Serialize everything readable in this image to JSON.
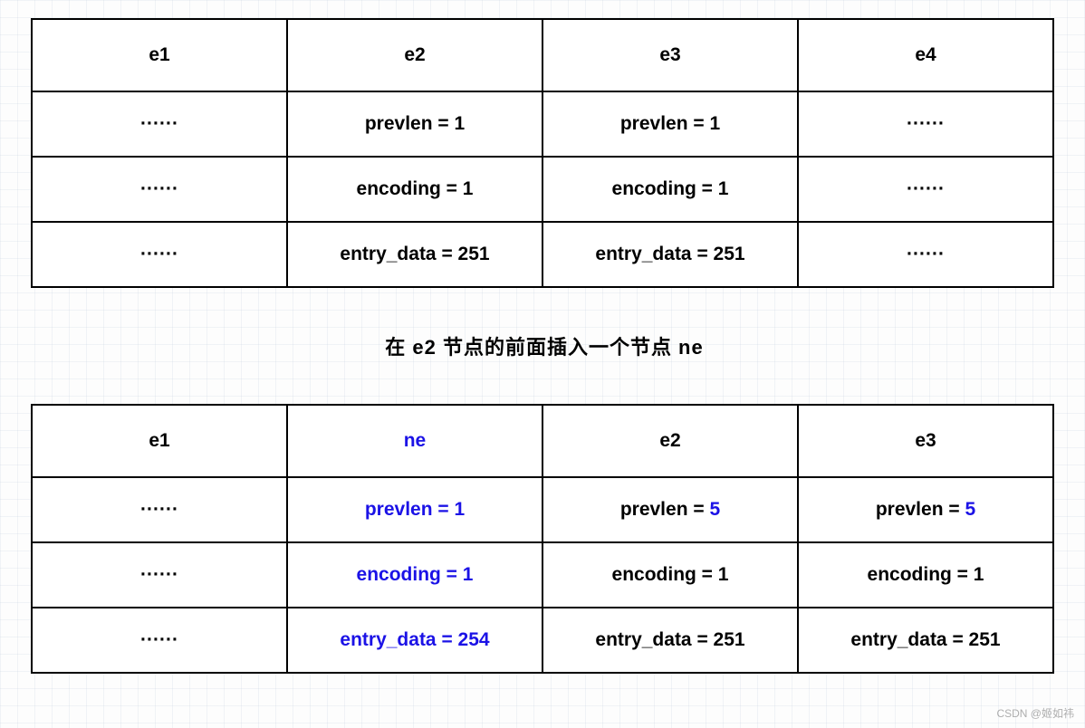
{
  "table1": {
    "headers": [
      "e1",
      "e2",
      "e3",
      "e4"
    ],
    "rows": [
      [
        {
          "text": "······",
          "blue": false
        },
        {
          "text": "prevlen = 1",
          "blue": false
        },
        {
          "text": "prevlen = 1",
          "blue": false
        },
        {
          "text": "······",
          "blue": false
        }
      ],
      [
        {
          "text": "······",
          "blue": false
        },
        {
          "text": "encoding = 1",
          "blue": false
        },
        {
          "text": "encoding = 1",
          "blue": false
        },
        {
          "text": "······",
          "blue": false
        }
      ],
      [
        {
          "text": "······",
          "blue": false
        },
        {
          "text": "entry_data = 251",
          "blue": false
        },
        {
          "text": "entry_data = 251",
          "blue": false
        },
        {
          "text": "······",
          "blue": false
        }
      ]
    ]
  },
  "caption": "在 e2 节点的前面插入一个节点 ne",
  "table2": {
    "headers": [
      {
        "text": "e1",
        "blue": false
      },
      {
        "text": "ne",
        "blue": true
      },
      {
        "text": "e2",
        "blue": false
      },
      {
        "text": "e3",
        "blue": false
      }
    ],
    "rows": [
      [
        {
          "text": "······",
          "blue": false
        },
        {
          "text": "prevlen = 1",
          "blue": true
        },
        {
          "prefix": "prevlen = ",
          "value": "5",
          "blueValue": true
        },
        {
          "prefix": "prevlen = ",
          "value": "5",
          "blueValue": true
        }
      ],
      [
        {
          "text": "······",
          "blue": false
        },
        {
          "text": "encoding = 1",
          "blue": true
        },
        {
          "text": "encoding = 1",
          "blue": false
        },
        {
          "text": "encoding = 1",
          "blue": false
        }
      ],
      [
        {
          "text": "······",
          "blue": false
        },
        {
          "text": "entry_data = 254",
          "blue": true
        },
        {
          "text": "entry_data = 251",
          "blue": false
        },
        {
          "text": "entry_data = 251",
          "blue": false
        }
      ]
    ]
  },
  "watermark": "CSDN @姬如祎"
}
